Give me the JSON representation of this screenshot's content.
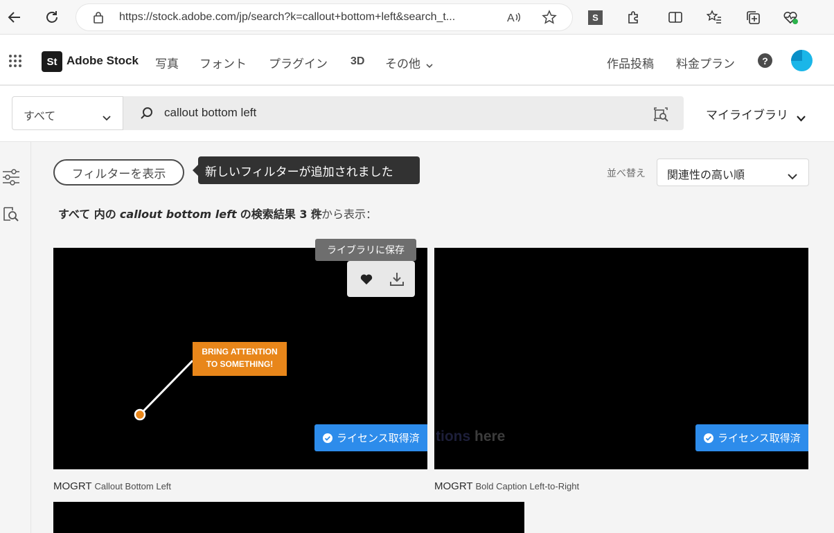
{
  "browser": {
    "url": "https://stock.adobe.com/jp/search?k=callout+bottom+left&search_t...",
    "ext_badge": "S"
  },
  "nav": {
    "brand_logo": "St",
    "brand": "Adobe Stock",
    "links": [
      "写真",
      "フォント",
      "プラグイン",
      "3D",
      "その他"
    ],
    "right_links": [
      "作品投稿",
      "料金プラン"
    ],
    "help": "?"
  },
  "search": {
    "scope": "すべて",
    "query": "callout bottom left",
    "my_library": "マイライブラリ"
  },
  "filters": {
    "show_filters": "フィルターを表示",
    "new_filter_tip": "新しいフィルターが追加されました",
    "sort_label": "並べ替え",
    "sort_value": "関連性の高い順"
  },
  "results": {
    "prefix": "すべて 内の",
    "query": "callout bottom left",
    "suffix": "の検索結果 3 件",
    "show_from": "次から表示："
  },
  "tooltip": {
    "save_to_library": "ライブラリに保存"
  },
  "items": [
    {
      "type": "MOGRT",
      "title": "Callout Bottom Left",
      "license": "ライセンス取得済",
      "callout_line1": "BRING ATTENTION",
      "callout_line2": "TO SOMETHING!"
    },
    {
      "type": "MOGRT",
      "title": "Bold Caption Left-to-Right",
      "license": "ライセンス取得済",
      "overlay_text_faded": "tions",
      "overlay_text": " here"
    }
  ],
  "colors": {
    "accent_blue": "#2d8ceb",
    "callout_orange": "#e8861a",
    "avatar": "#1ab6e8"
  }
}
